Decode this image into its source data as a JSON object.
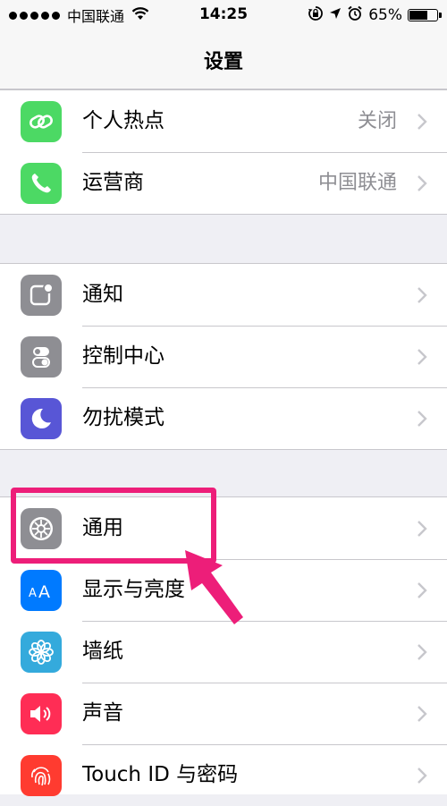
{
  "status_bar": {
    "carrier": "中国联通",
    "time": "14:25",
    "battery": "65%",
    "battery_level": 0.65
  },
  "nav": {
    "title": "设置"
  },
  "groups": [
    {
      "rows": [
        {
          "label": "个人热点",
          "value": "关闭",
          "icon": "hotspot-icon",
          "color": "#4cd964"
        },
        {
          "label": "运营商",
          "value": "中国联通",
          "icon": "phone-icon",
          "color": "#4cd964"
        }
      ]
    },
    {
      "rows": [
        {
          "label": "通知",
          "value": "",
          "icon": "notification-icon",
          "color": "#8e8e93"
        },
        {
          "label": "控制中心",
          "value": "",
          "icon": "control-center-icon",
          "color": "#8e8e93"
        },
        {
          "label": "勿扰模式",
          "value": "",
          "icon": "moon-icon",
          "color": "#5856d6"
        }
      ]
    },
    {
      "rows": [
        {
          "label": "通用",
          "value": "",
          "icon": "gear-icon",
          "color": "#8e8e93"
        },
        {
          "label": "显示与亮度",
          "value": "",
          "icon": "display-icon",
          "color": "#007aff"
        },
        {
          "label": "墙纸",
          "value": "",
          "icon": "wallpaper-icon",
          "color": "#34aadc"
        },
        {
          "label": "声音",
          "value": "",
          "icon": "sound-icon",
          "color": "#ff2d55"
        },
        {
          "label": "Touch ID 与密码",
          "value": "",
          "icon": "fingerprint-icon",
          "color": "#ff3b30"
        }
      ]
    }
  ],
  "annotation": {
    "color": "#ed1e79"
  }
}
